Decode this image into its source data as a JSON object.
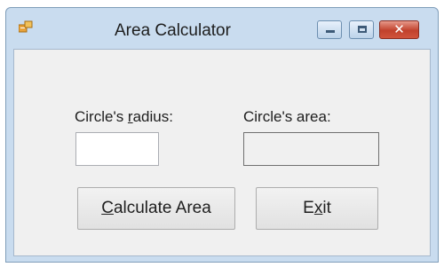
{
  "window": {
    "title": "Area Calculator",
    "icon": "app-form-icon",
    "controls": {
      "minimize": "minimize-icon",
      "maximize": "maximize-icon",
      "close_glyph": "✕"
    }
  },
  "form": {
    "radius_label": {
      "before": "Circle's ",
      "mnemonic": "r",
      "after": "adius:"
    },
    "area_label": "Circle's area:",
    "radius_input": {
      "value": "",
      "placeholder": ""
    },
    "area_output": ""
  },
  "buttons": {
    "calculate": {
      "mnemonic": "C",
      "after": "alculate Area"
    },
    "exit": {
      "before": "E",
      "mnemonic": "x",
      "after": "it"
    }
  },
  "colors": {
    "frame": "#c9dcef",
    "client": "#f0f0f0",
    "close_button": "#c1412c"
  }
}
